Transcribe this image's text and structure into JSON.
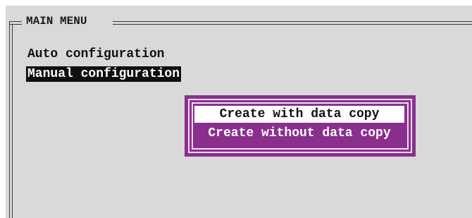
{
  "main_menu": {
    "title": "MAIN MENU",
    "items": [
      {
        "label": "Auto configuration",
        "selected": false
      },
      {
        "label": "Manual configuration",
        "selected": true
      }
    ]
  },
  "popup": {
    "options": [
      {
        "label": "Create with data copy",
        "selected": true
      },
      {
        "label": "Create without data copy",
        "selected": false
      }
    ]
  },
  "colors": {
    "panel_background": "#d9d9d9",
    "frame_line": "#3a3a3a",
    "selection_background": "#0f0f0f",
    "selection_text": "#ffffff",
    "popup_background": "#8a2f8e",
    "popup_border": "#f1dff1",
    "popup_highlight": "#ffffff"
  }
}
